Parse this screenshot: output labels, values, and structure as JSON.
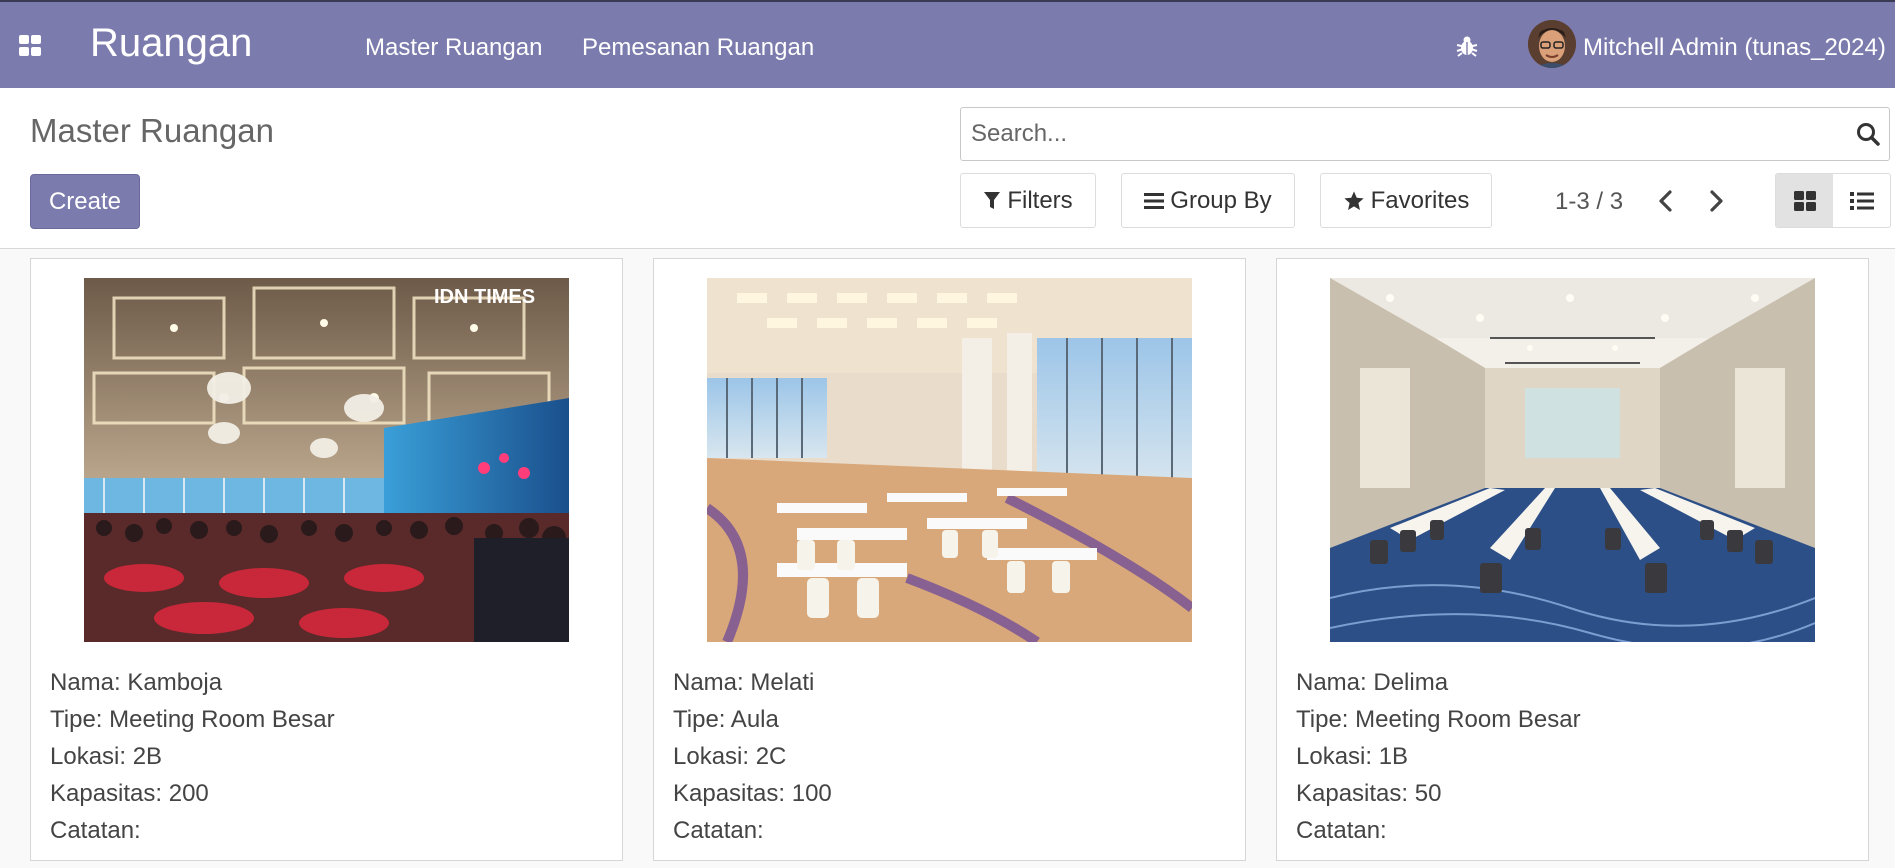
{
  "navbar": {
    "app_title": "Ruangan",
    "menu": [
      "Master Ruangan",
      "Pemesanan Ruangan"
    ],
    "user_name": "Mitchell Admin (tunas_2024)"
  },
  "control_panel": {
    "page_title": "Master Ruangan",
    "create_label": "Create",
    "search_placeholder": "Search...",
    "filters_label": "Filters",
    "group_by_label": "Group By",
    "favorites_label": "Favorites",
    "pager": "1-3 / 3"
  },
  "rooms": [
    {
      "nama": "Nama: Kamboja",
      "tipe": "Tipe: Meeting Room Besar",
      "lokasi": "Lokasi: 2B",
      "kapasitas": "Kapasitas: 200",
      "catatan": "Catatan:",
      "watermark": "IDN TIMES"
    },
    {
      "nama": "Nama: Melati",
      "tipe": "Tipe: Aula",
      "lokasi": "Lokasi: 2C",
      "kapasitas": "Kapasitas: 100",
      "catatan": "Catatan:"
    },
    {
      "nama": "Nama: Delima",
      "tipe": "Tipe: Meeting Room Besar",
      "lokasi": "Lokasi: 1B",
      "kapasitas": "Kapasitas: 50",
      "catatan": "Catatan:"
    }
  ],
  "colors": {
    "brand": "#7c7bad",
    "background": "#f9f9f9",
    "card_border": "#d6d6d6"
  },
  "icons": {
    "apps": "apps-grid-icon",
    "bug": "bug-icon",
    "search": "search-icon",
    "filter": "filter-icon",
    "group_by": "list-bars-icon",
    "favorites": "star-icon",
    "pager_prev": "chevron-left-icon",
    "pager_next": "chevron-right-icon",
    "kanban_view": "kanban-grid-icon",
    "list_view": "list-view-icon"
  }
}
